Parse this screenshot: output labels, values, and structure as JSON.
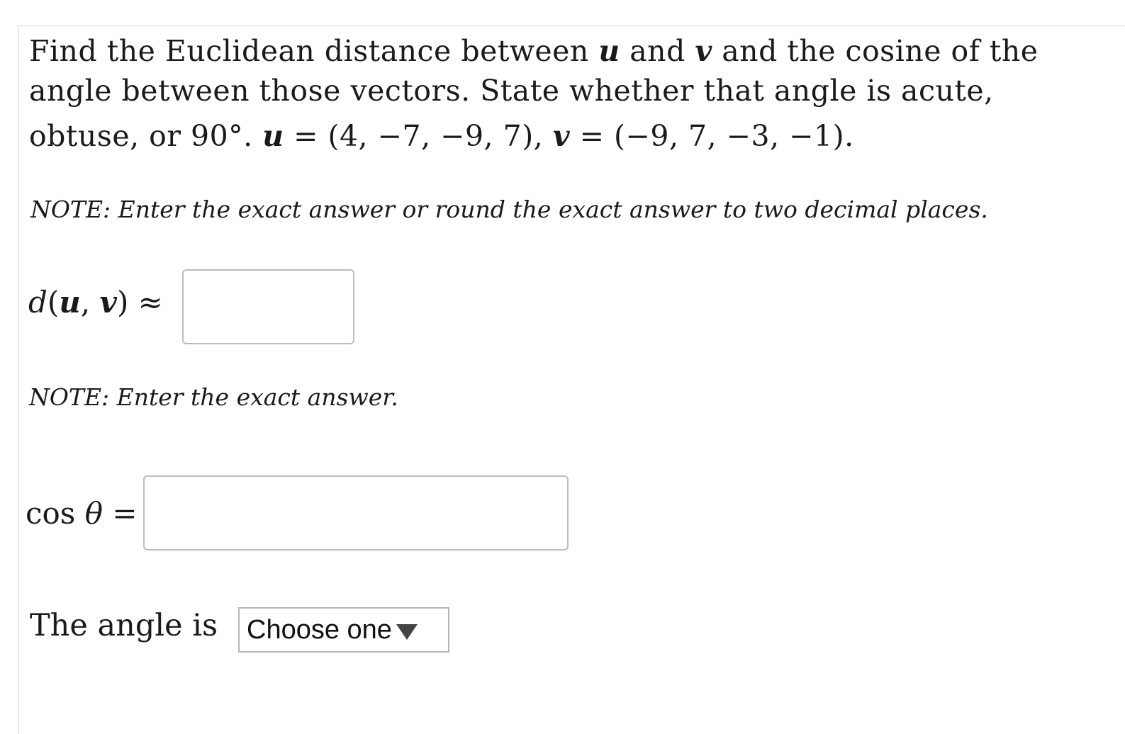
{
  "question": {
    "line1_a": "Find the Euclidean distance between ",
    "u_symbol": "u",
    "line1_b": " and ",
    "v_symbol": "v",
    "line1_c": " and the cosine of the",
    "line2": "angle between those vectors. State whether that angle is acute,",
    "line3_a": "obtuse, or 90°. ",
    "u_eq": " = (4, −7, −9, 7),  ",
    "v_eq": " = (−9, 7, −3, −1)."
  },
  "note1": "NOTE: Enter the exact answer or round the exact answer to two decimal places.",
  "distance": {
    "label_d": "d",
    "label_open": "(",
    "label_u": "u",
    "label_comma": ", ",
    "label_v": "v",
    "label_close": ") ≈",
    "value": ""
  },
  "note2": "NOTE: Enter the exact answer.",
  "cosine": {
    "label_cos": "cos ",
    "label_theta": "θ",
    "label_eq": " =",
    "value": ""
  },
  "angle": {
    "label": "The angle is",
    "select_value": "Choose one"
  }
}
